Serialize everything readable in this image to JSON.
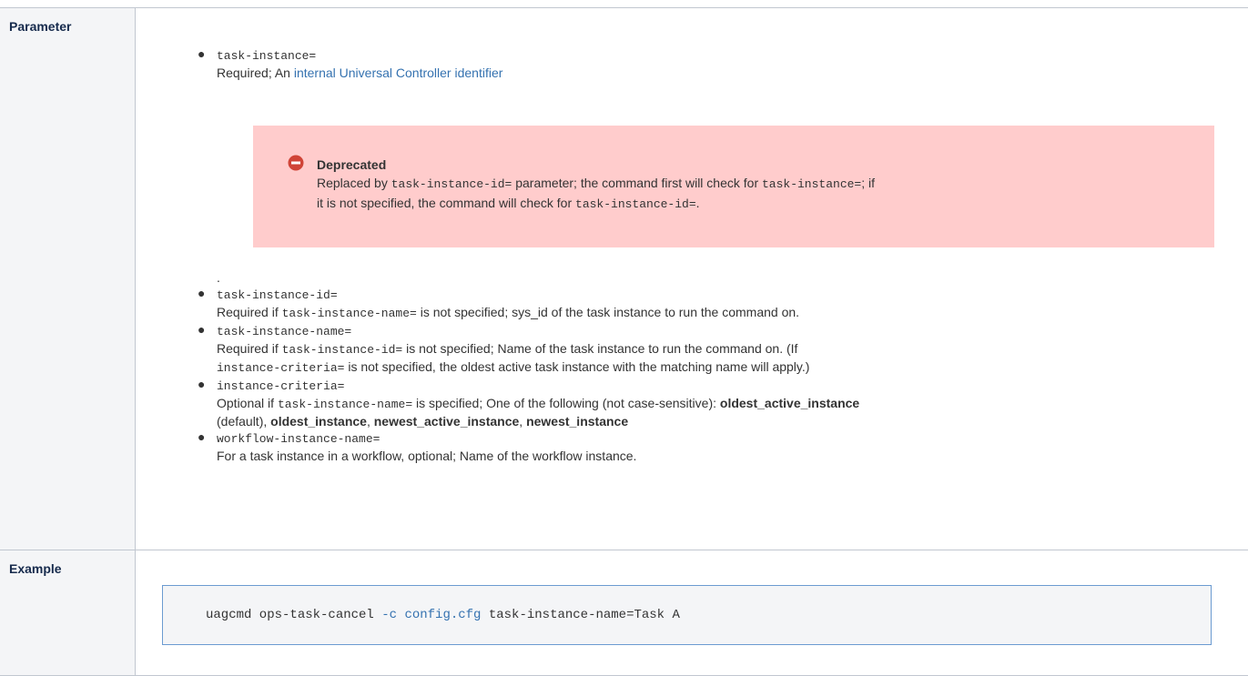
{
  "table": {
    "param_header": "Parameter",
    "example_header": "Example"
  },
  "params": {
    "p1_name": "task-instance=",
    "p1_desc_prefix": "Required; An ",
    "p1_link": "internal Universal Controller identifier",
    "deprecated_title": "Deprecated",
    "dep_a": "Replaced by ",
    "dep_code1": "task-instance-id=",
    "dep_b": " parameter; the command first will check for ",
    "dep_code2": "task-instance=",
    "dep_c": "; if",
    "dep_d": "it is not specified, the command will check for ",
    "dep_code3": "task-instance-id=",
    "dep_e": ".",
    "dot": ".",
    "p2_name": "task-instance-id=",
    "p2_a": "Required if ",
    "p2_code": "task-instance-name=",
    "p2_b": " is not specified; sys_id of the task instance to run the command on.",
    "p3_name": "task-instance-name=",
    "p3_a": "Required if ",
    "p3_code": "task-instance-id=",
    "p3_b": " is not specified; Name of the task instance to run the command on. (If",
    "p3_code2": "instance-criteria=",
    "p3_c": " is not specified, the oldest active task instance with the matching name will apply.)",
    "p4_name": "instance-criteria=",
    "p4_a": "Optional if ",
    "p4_code": "task-instance-name=",
    "p4_b": " is specified; One of the following (not case-sensitive): ",
    "p4_opt1": "oldest_active_instance",
    "p4_c": "(default), ",
    "p4_opt2": "oldest_instance",
    "p4_sep1": ", ",
    "p4_opt3": "newest_active_instance",
    "p4_sep2": ", ",
    "p4_opt4": "newest_instance",
    "p5_name": "workflow-instance-name=",
    "p5_desc": "For a task instance in a workflow, optional; Name of the workflow instance."
  },
  "example": {
    "cmd": "uagcmd ops-task-cancel ",
    "flag": "-c config.cfg",
    "rest": " task-instance-name=Task A"
  },
  "colors": {
    "header_bg": "#f4f5f7",
    "header_text": "#172b4d",
    "link": "#3572b0",
    "deprecated_bg": "#ffcccc",
    "deprecated_icon": "#d04437",
    "code_border": "#6b9bd1"
  }
}
